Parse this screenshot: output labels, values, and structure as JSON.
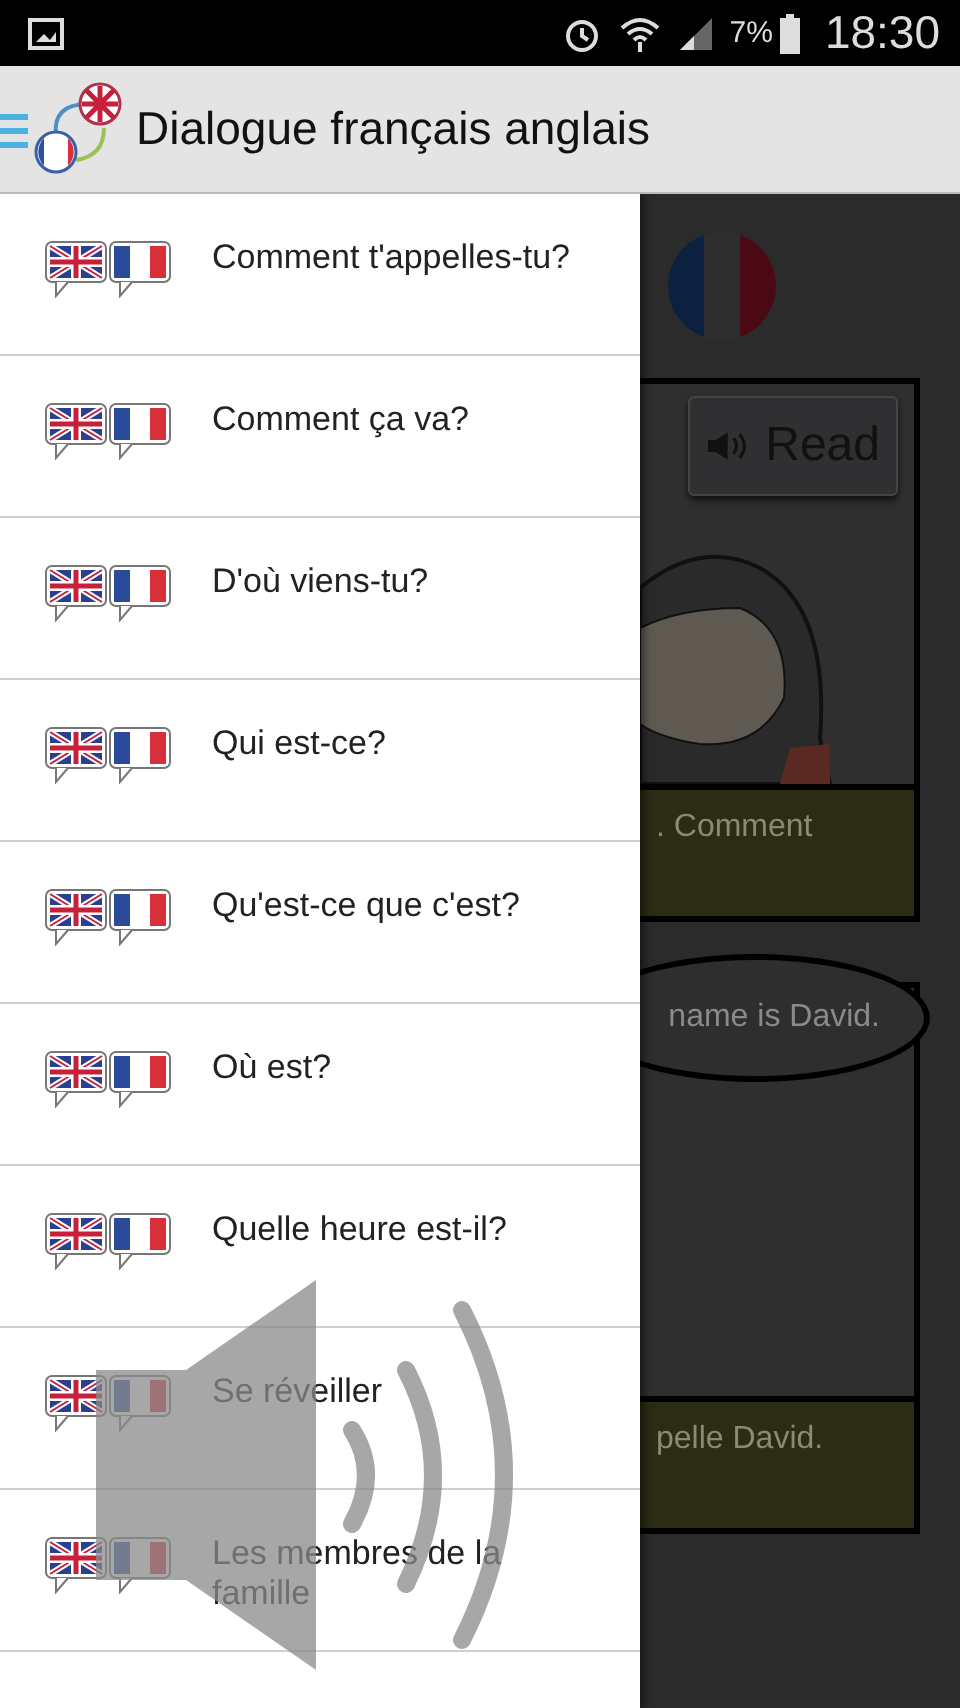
{
  "status_bar": {
    "battery": "7%",
    "time": "18:30"
  },
  "app_bar": {
    "title": "Dialogue français anglais"
  },
  "drawer": {
    "items": [
      {
        "label": "Comment t'appelles-tu?"
      },
      {
        "label": "Comment ça va?"
      },
      {
        "label": "D'où viens-tu?"
      },
      {
        "label": "Qui est-ce?"
      },
      {
        "label": "Qu'est-ce que c'est?"
      },
      {
        "label": "Où est?"
      },
      {
        "label": "Quelle heure est-il?"
      },
      {
        "label": "Se réveiller"
      },
      {
        "label": "Les membres de la famille"
      }
    ]
  },
  "background": {
    "read_button": "Read",
    "caption_1": ". Comment",
    "bubble": "name is David.",
    "caption_2": "pelle David."
  }
}
